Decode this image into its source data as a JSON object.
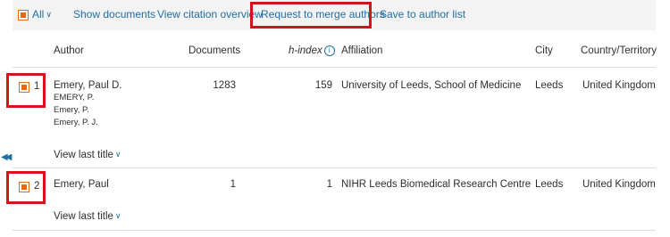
{
  "toolbar": {
    "select_all_label": "All",
    "show_documents": "Show documents",
    "view_citation_overview": "View citation overview",
    "request_merge": "Request to merge authors",
    "save_to_author_list": "Save to author list"
  },
  "columns": {
    "author": "Author",
    "documents": "Documents",
    "h_index": "h-index",
    "affiliation": "Affiliation",
    "city": "City",
    "country": "Country/Territory"
  },
  "rows": [
    {
      "number": "1",
      "author": "Emery, Paul D.",
      "variants": [
        "EMERY, P.",
        "Emery, P.",
        "Emery, P. J."
      ],
      "documents": "1283",
      "h_index": "159",
      "affiliation": "University of Leeds, School of Medicine",
      "city": "Leeds",
      "country": "United Kingdom",
      "view_last_title": "View last title"
    },
    {
      "number": "2",
      "author": "Emery, Paul",
      "variants": [],
      "documents": "1",
      "h_index": "1",
      "affiliation": "NIHR Leeds Biomedical Research Centre",
      "city": "Leeds",
      "country": "United Kingdom",
      "view_last_title": "View last title"
    }
  ],
  "icons": {
    "select_all_dropdown": "chevron-down-icon",
    "info": "info-icon",
    "sidebar_collapse": "double-chevron-left-icon"
  },
  "colors": {
    "link": "#1f6fa8",
    "checkbox": "#e8670f",
    "highlight": "#d2151b",
    "toolbar_bg": "#f3f3f3"
  }
}
